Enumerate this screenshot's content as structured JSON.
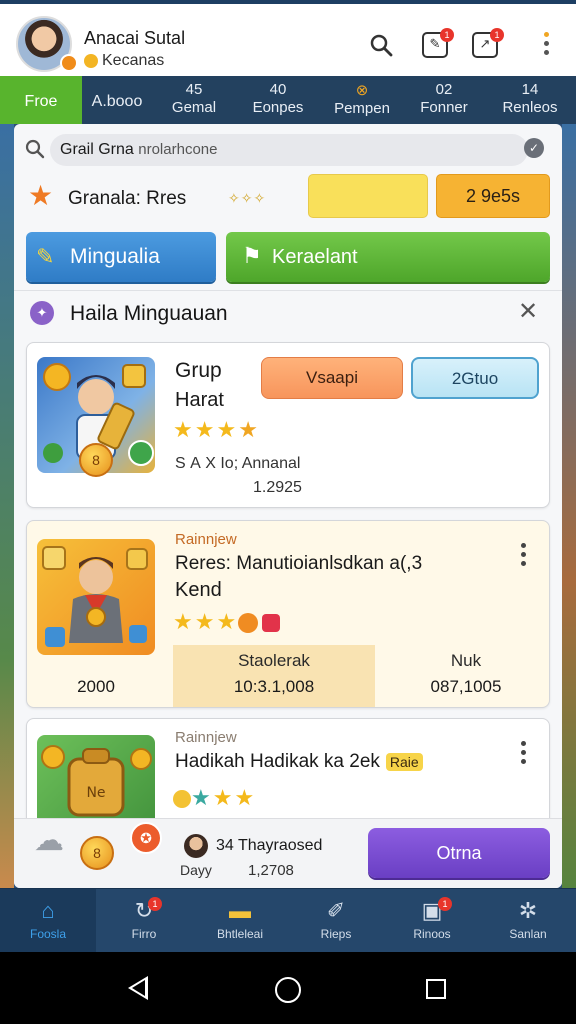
{
  "header": {
    "profile_name": "Anacai Sutal",
    "profile_sub": "Kecanas",
    "notif_badge_1": "1",
    "notif_badge_2": "1"
  },
  "statbar": {
    "free_label": "Froe",
    "book_label": "A.booo",
    "tabs": [
      {
        "value": "45",
        "label": "Gemal"
      },
      {
        "value": "40",
        "label": "Eonpes"
      },
      {
        "value": "",
        "label": "Pempen"
      },
      {
        "value": "02",
        "label": "Fonner"
      },
      {
        "value": "14",
        "label": "Renleos"
      }
    ]
  },
  "search": {
    "query": "Grail Grna",
    "hint": "nrolarhcone"
  },
  "section": {
    "title": "Granala: Rres",
    "badge_value": "2 9e5s"
  },
  "actions": {
    "blue_label": "Mingualia",
    "green_label": "Keraelant"
  },
  "group": {
    "title": "Haila Minguauan"
  },
  "cards": [
    {
      "title": "Grup",
      "subtitle": "Harat",
      "btn_left": "Vsaapi",
      "btn_right": "2Gtuo",
      "meta": "S A X Io; Annanal",
      "meta_num": "1.2925",
      "coin_label": "8",
      "rating": 4
    },
    {
      "overline": "Rainnjew",
      "title": "Reres: Manutioianlsdkan a(,3",
      "subtitle": "Kend",
      "left_value": "2000",
      "mid_label": "Staolerak",
      "mid_value": "10:3.1,008",
      "right_label": "Nuk",
      "right_value": "087,1005",
      "rating": 3
    },
    {
      "overline": "Rainnjew",
      "title": "Hadikah Hadikak ka 2ek",
      "tag": "Raie"
    }
  ],
  "strip": {
    "coin_label": "8",
    "line1": "34  Thayraosed",
    "day": "Dayy",
    "number": "1,2708",
    "button_label": "Otrna"
  },
  "nav": [
    {
      "label": "Foosla",
      "icon": "home-icon"
    },
    {
      "label": "Firro",
      "icon": "refresh-icon",
      "badge": "1"
    },
    {
      "label": "Bhtleleai",
      "icon": "folder-icon"
    },
    {
      "label": "Rieps",
      "icon": "wrench-icon"
    },
    {
      "label": "Rinoos",
      "icon": "image-icon",
      "badge": "1"
    },
    {
      "label": "Sanlan",
      "icon": "gear-icon"
    }
  ],
  "colors": {
    "accent_green": "#58b42d",
    "header_navy": "#23415f",
    "purple": "#7a4ad4"
  }
}
